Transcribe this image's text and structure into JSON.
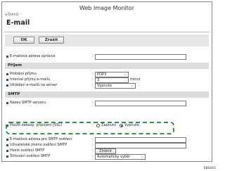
{
  "window": {
    "title": "Web Image Monitor"
  },
  "nav": {
    "back": "◂ Domů"
  },
  "page": {
    "title": "E-mail"
  },
  "toolbar": {
    "ok": "OK",
    "cancel": "Zrušit"
  },
  "admin": {
    "label": "E-mailová adresa správce",
    "value": ""
  },
  "sections": {
    "receive": "Příjem",
    "smtp": "SMTP"
  },
  "receive": {
    "protocol": {
      "label": "Protokol příjmu",
      "value": "POP3"
    },
    "interval": {
      "label": "Interval příjmu e-mailu",
      "value": "3",
      "unit": "minut"
    },
    "save": {
      "label": "Ukládání e-mailů na server",
      "value": "Vypnuto"
    }
  },
  "smtp": {
    "server": {
      "label": "Název SMTP serveru",
      "value": ""
    },
    "secure": {
      "label": "Použít zabezp. připojení (SSL)",
      "on": "Zapnuto",
      "off": "Vypnuto",
      "selected": "off"
    },
    "auth_email": {
      "label": "E-mailová adresa pro SMTP ověření",
      "value": ""
    },
    "auth_user": {
      "label": "Uživatelské jméno ověření SMTP",
      "value": ""
    },
    "auth_pass": {
      "label": "Heslo ověření SMTP",
      "button": "Změnit"
    },
    "auth_enc": {
      "label": "Šifrování ověření SMTP",
      "value": "Automatický výběr"
    }
  },
  "figure_code": "EBS065",
  "colors": {
    "highlight": "#2e9a3c",
    "bullet": "#1f4f9a",
    "section_bg": "#dcdcdc"
  }
}
